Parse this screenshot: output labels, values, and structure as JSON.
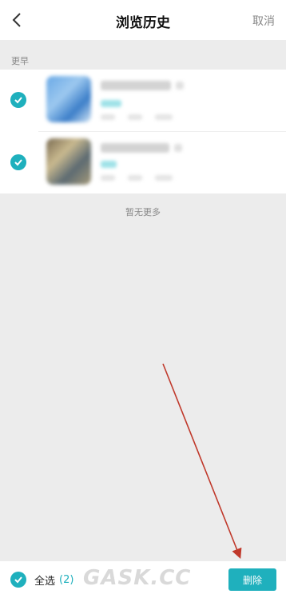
{
  "header": {
    "title": "浏览历史",
    "cancel_label": "取消",
    "back_icon": "chevron-left-icon"
  },
  "section": {
    "label": "更早"
  },
  "items": [
    {
      "checked": true
    },
    {
      "checked": true
    }
  ],
  "list_footer": "暂无更多",
  "bottom_bar": {
    "select_all_label": "全选",
    "select_count": "(2)",
    "delete_label": "删除"
  },
  "watermark": "GASK.CC",
  "colors": {
    "accent": "#1fb0bd",
    "arrow": "#c0392b"
  }
}
